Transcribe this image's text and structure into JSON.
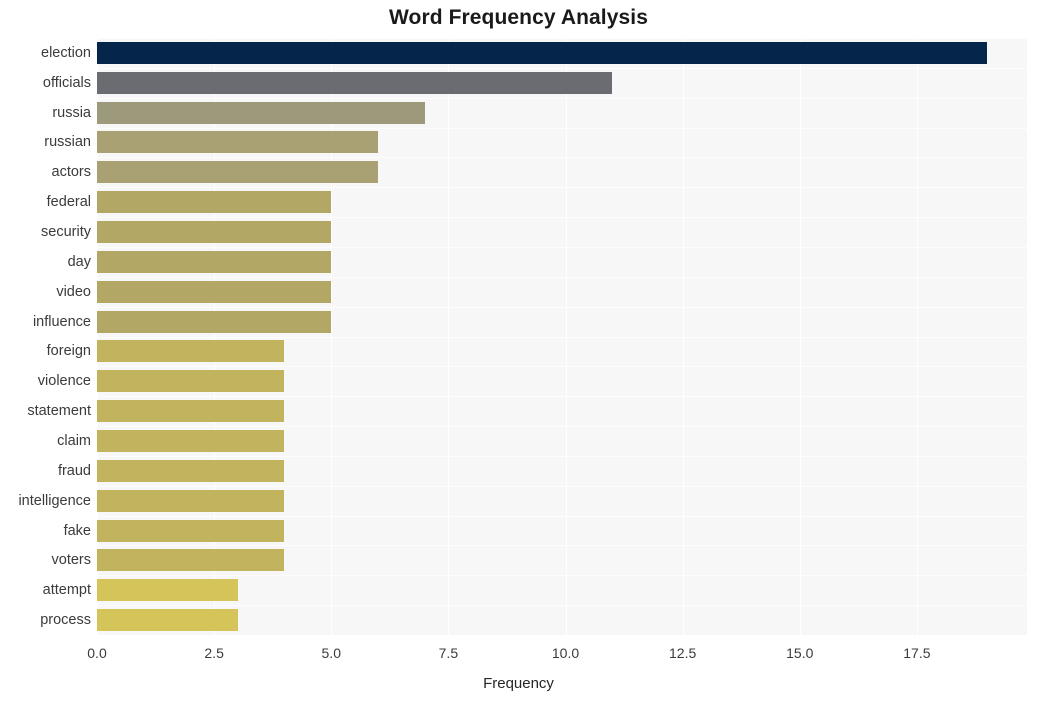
{
  "chart_data": {
    "type": "bar",
    "orientation": "horizontal",
    "title": "Word Frequency Analysis",
    "xlabel": "Frequency",
    "ylabel": "",
    "categories": [
      "election",
      "officials",
      "russia",
      "russian",
      "actors",
      "federal",
      "security",
      "day",
      "video",
      "influence",
      "foreign",
      "violence",
      "statement",
      "claim",
      "fraud",
      "intelligence",
      "fake",
      "voters",
      "attempt",
      "process"
    ],
    "values": [
      19,
      11,
      7,
      6,
      6,
      5,
      5,
      5,
      5,
      5,
      4,
      4,
      4,
      4,
      4,
      4,
      4,
      4,
      3,
      3
    ],
    "bar_colors": [
      "#06254b",
      "#6b6b72",
      "#9d9a7c",
      "#a9a173",
      "#a9a173",
      "#b3a766",
      "#b3a766",
      "#b3a766",
      "#b3a766",
      "#b3a766",
      "#c2b45f",
      "#c2b45f",
      "#c2b45f",
      "#c2b45f",
      "#c2b45f",
      "#c2b45f",
      "#c2b45f",
      "#c2b45f",
      "#d4c459",
      "#d4c459"
    ],
    "xlim": [
      0,
      19.85
    ],
    "xticks": [
      0,
      2.5,
      5,
      7.5,
      10,
      12.5,
      15,
      17.5
    ],
    "xtick_labels": [
      "0.0",
      "2.5",
      "5.0",
      "7.5",
      "10.0",
      "12.5",
      "15.0",
      "17.5"
    ],
    "grid": true,
    "grid_axis": "both",
    "legend": "none",
    "plot_background": "#f7f7f7",
    "figure_background": "#ffffff"
  }
}
